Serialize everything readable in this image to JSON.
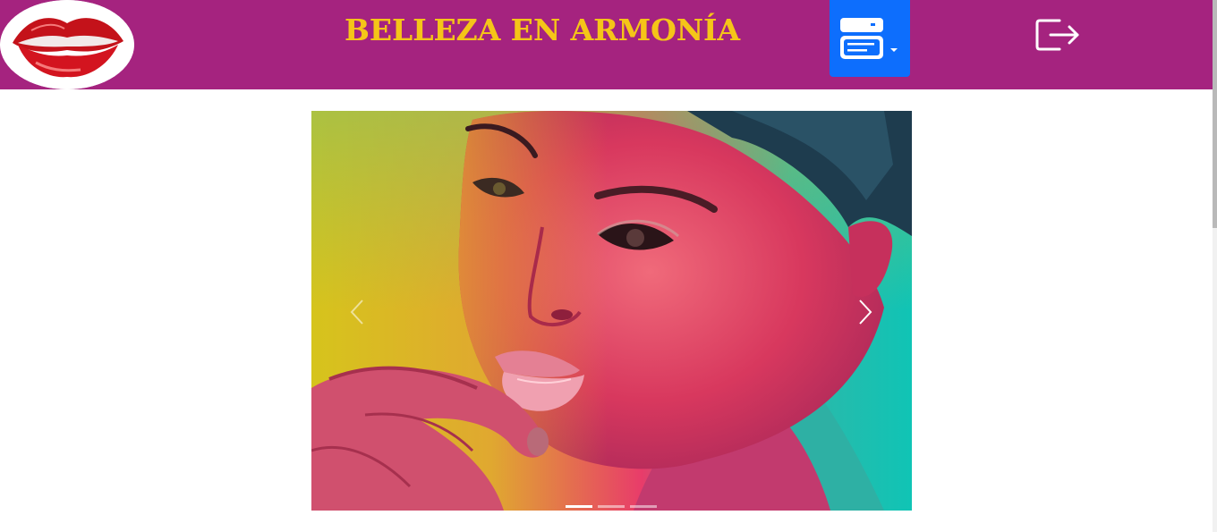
{
  "header": {
    "brand_title": "BELLEZA EN ARMONÍA",
    "logo_icon": "lips-logo",
    "menu_button_icon": "server-menu-icon",
    "logout_icon": "logout-icon"
  },
  "colors": {
    "navbar": "#a5237f",
    "brand": "#f5c518",
    "menu_button": "#0d6efd"
  },
  "carousel": {
    "slide_count": 3,
    "active_slide": 1,
    "prev_icon": "chevron-left-icon",
    "next_icon": "chevron-right-icon",
    "slide_image": "woman-neon-makeup-portrait"
  }
}
